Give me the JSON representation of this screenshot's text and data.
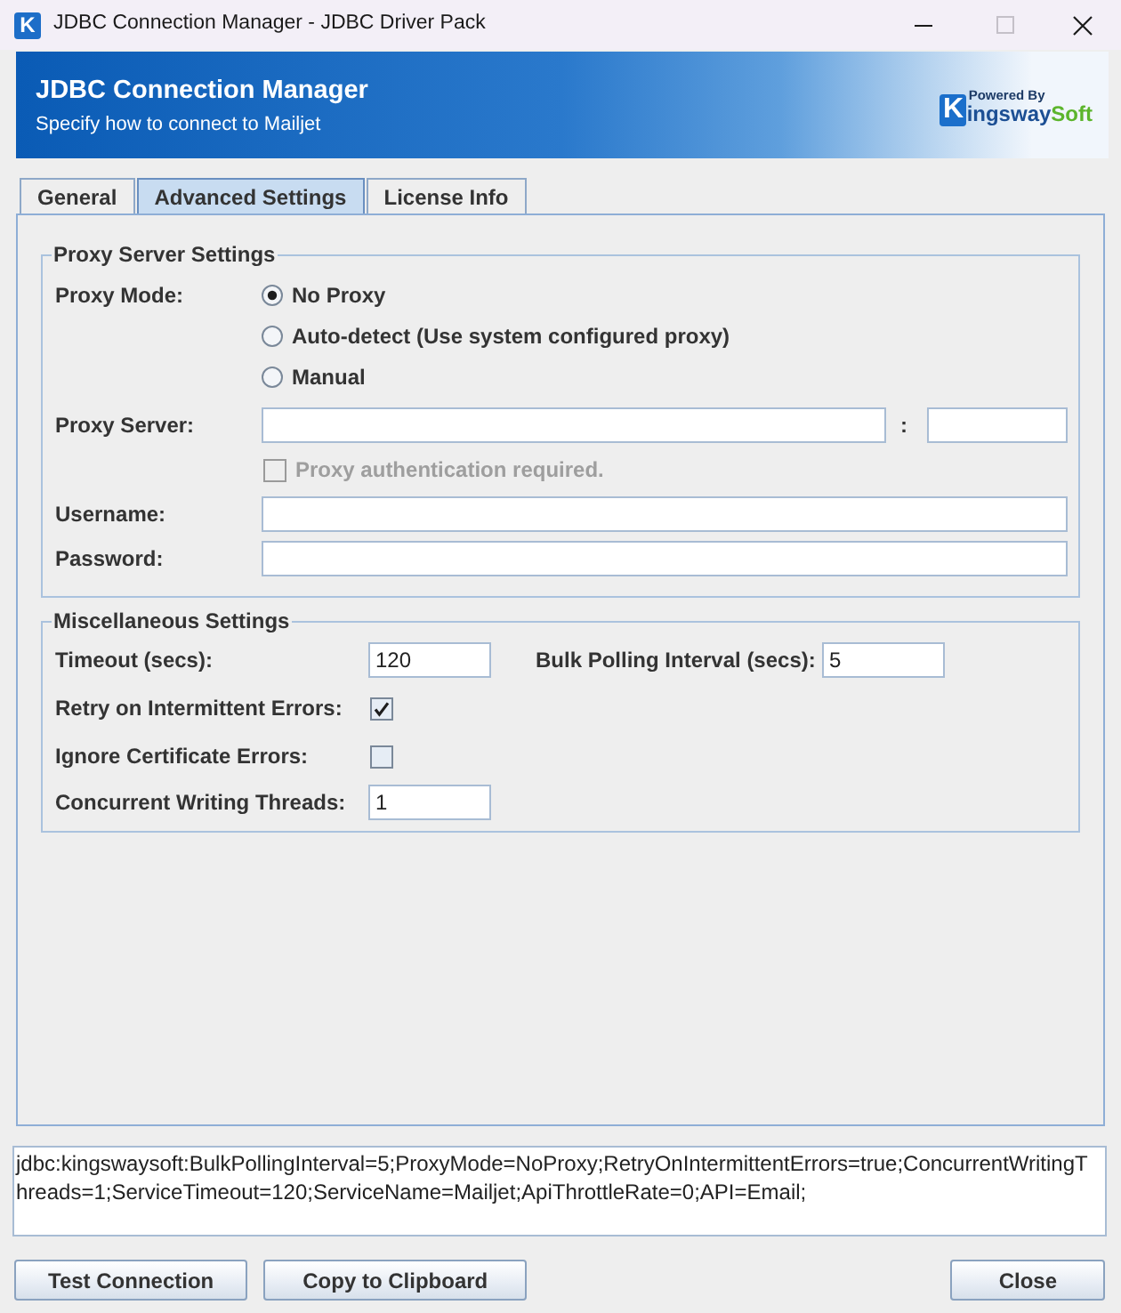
{
  "window": {
    "title": "JDBC Connection Manager - JDBC Driver Pack",
    "icon_letter": "K",
    "maximize_disabled": true
  },
  "banner": {
    "title": "JDBC Connection Manager",
    "subtitle": "Specify how to connect to Mailjet",
    "logo": {
      "caption": "Powered By",
      "initial": "K",
      "name": "ingsway",
      "name_accent": "Soft"
    }
  },
  "tabs": [
    {
      "label": "General",
      "selected": false
    },
    {
      "label": "Advanced Settings",
      "selected": true
    },
    {
      "label": "License Info",
      "selected": false
    }
  ],
  "proxy_settings": {
    "legend": "Proxy Server Settings",
    "mode": {
      "label": "Proxy Mode:",
      "options": [
        {
          "label": "No Proxy",
          "selected": true
        },
        {
          "label": "Auto-detect (Use system configured proxy)",
          "selected": false
        },
        {
          "label": "Manual",
          "selected": false
        }
      ]
    },
    "server": {
      "label": "Proxy Server:",
      "separator": ":"
    },
    "authentication": {
      "label": "Proxy authentication required.",
      "checked": false,
      "disabled": true
    },
    "username": {
      "label": "Username:"
    },
    "password": {
      "label": "Password:"
    }
  },
  "misc_settings": {
    "legend": "Miscellaneous Settings",
    "timeout": {
      "label": "Timeout (secs):",
      "value": "120"
    },
    "bulk_polling_interval": {
      "label": "Bulk Polling Interval (secs):",
      "value": "5"
    },
    "retry_on_errors": {
      "label": "Retry on Intermittent Errors:",
      "checked": true
    },
    "ignore_certificate_errors": {
      "label": "Ignore Certificate Errors:",
      "checked": false
    },
    "writing_threads": {
      "label": "Concurrent Writing Threads:",
      "value": "1"
    }
  },
  "connection_string": {
    "value": "jdbc:kingswaysoft:BulkPollingInterval=5;ProxyMode=NoProxy;RetryOnIntermittentErrors=true;ConcurrentWritingThreads=1;ServiceTimeout=120;ServiceName=Mailjet;ApiThrottleRate=0;API=Email;"
  },
  "buttons": [
    {
      "label": "Test Connection"
    },
    {
      "label": "Copy to Clipboard"
    },
    {
      "label": "Close"
    }
  ]
}
